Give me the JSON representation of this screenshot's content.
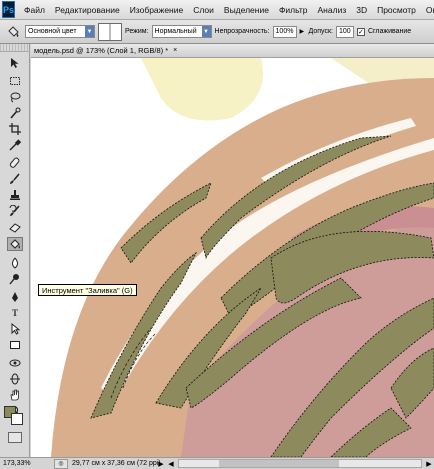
{
  "app": {
    "logo": "Ps"
  },
  "menu": [
    "Файл",
    "Редактирование",
    "Изображение",
    "Слои",
    "Выделение",
    "Фильтр",
    "Анализ",
    "3D",
    "Просмотр",
    "Окно"
  ],
  "options": {
    "fill_source": "Основной цвет",
    "mode_label": "Режим:",
    "mode_value": "Нормальный",
    "opacity_label": "Непрозрачность:",
    "opacity_value": "100%",
    "tolerance_label": "Допуск:",
    "tolerance_value": "100",
    "antialias_label": "Сглаживание"
  },
  "document": {
    "tab_title": "модель.psd @ 173% (Слой 1, RGB/8) *",
    "close": "×"
  },
  "tooltip": "Инструмент \"Заливка\" (G)",
  "status": {
    "zoom": "173,33%",
    "doc_info": "29,77 см x 37,36 см (72 ppi)"
  },
  "colors": {
    "foreground": "#8b8a5a",
    "background": "#ffffff",
    "skin": "#d9ae8c",
    "stripes": "#8d8a5e",
    "pink": "#cc9a9a",
    "highlight": "#f6f2c6"
  },
  "tools": [
    "move-icon",
    "marquee-icon",
    "lasso-icon",
    "quick-select-icon",
    "crop-icon",
    "eyedropper-icon",
    "healing-icon",
    "brush-icon",
    "clone-stamp-icon",
    "history-brush-icon",
    "eraser-icon",
    "paint-bucket-icon",
    "blur-icon",
    "dodge-icon",
    "pen-icon",
    "type-icon",
    "path-select-icon",
    "rectangle-icon",
    "3d-rotate-icon",
    "3d-orbit-icon",
    "hand-icon",
    "zoom-icon"
  ]
}
